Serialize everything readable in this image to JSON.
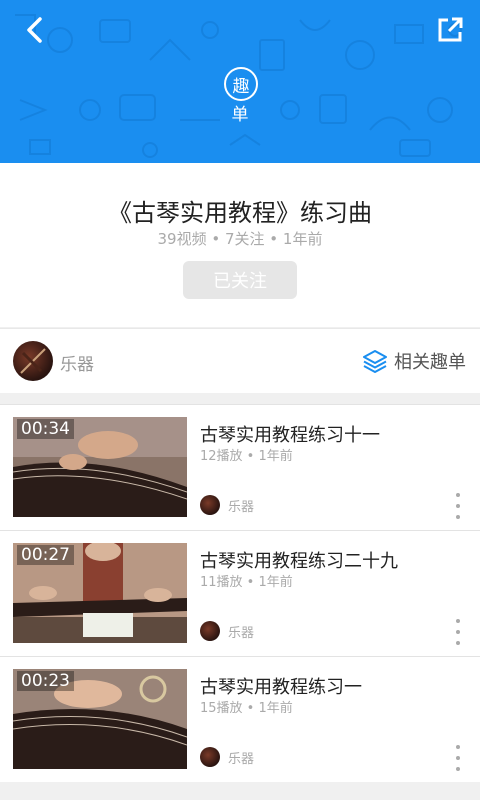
{
  "header": {
    "logo_char": "趣",
    "logo_label": "单",
    "background_color": "#1a8ef0"
  },
  "collection": {
    "title": "《古琴实用教程》练习曲",
    "meta": "39视频 • 7关注 • 1年前",
    "follow_label": "已关注"
  },
  "owner": {
    "name": "乐器",
    "related_label": "相关趣单"
  },
  "videos": [
    {
      "duration": "00:34",
      "title": "古琴实用教程练习十一",
      "meta": "12播放 • 1年前",
      "owner": "乐器"
    },
    {
      "duration": "00:27",
      "title": "古琴实用教程练习二十九",
      "meta": "11播放 • 1年前",
      "owner": "乐器"
    },
    {
      "duration": "00:23",
      "title": "古琴实用教程练习一",
      "meta": "15播放 • 1年前",
      "owner": "乐器"
    }
  ],
  "icons": {
    "back": "chevron-left-icon",
    "share": "external-link-icon",
    "related": "layers-icon",
    "more": "more-vertical-icon"
  },
  "colors": {
    "accent": "#1a8ef0"
  }
}
